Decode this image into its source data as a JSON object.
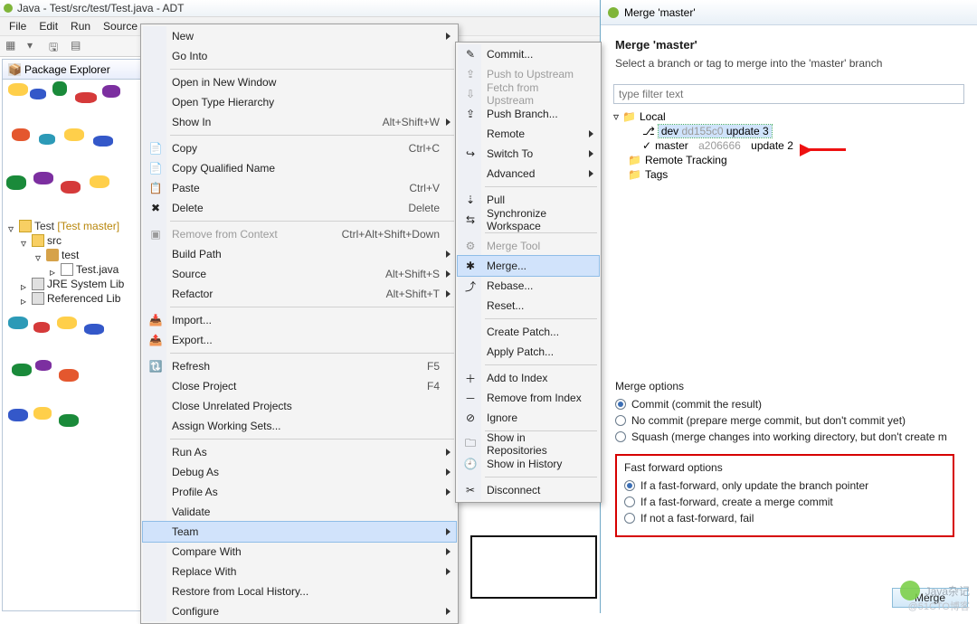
{
  "window": {
    "title": "Java - Test/src/test/Test.java - ADT"
  },
  "menubar": [
    "File",
    "Edit",
    "Run",
    "Source"
  ],
  "explorer": {
    "tab": "Package Explorer",
    "project": "Test",
    "project_deco": "[Test master]",
    "src": "src",
    "pkg": "test",
    "file": "Test.java",
    "jre": "JRE System Lib",
    "ref": "Referenced Lib"
  },
  "context": {
    "items": [
      {
        "label": "New",
        "arrow": true
      },
      {
        "label": "Go Into"
      },
      {
        "sep": true
      },
      {
        "label": "Open in New Window"
      },
      {
        "label": "Open Type Hierarchy"
      },
      {
        "label": "Show In",
        "sc": "Alt+Shift+W",
        "arrow": true
      },
      {
        "sep": true
      },
      {
        "label": "Copy",
        "sc": "Ctrl+C",
        "icon": "📄"
      },
      {
        "label": "Copy Qualified Name",
        "icon": "📄"
      },
      {
        "label": "Paste",
        "sc": "Ctrl+V",
        "icon": "📋"
      },
      {
        "label": "Delete",
        "sc": "Delete",
        "icon": "✖"
      },
      {
        "sep": true
      },
      {
        "label": "Remove from Context",
        "sc": "Ctrl+Alt+Shift+Down",
        "disabled": true,
        "icon": "▣"
      },
      {
        "label": "Build Path",
        "arrow": true
      },
      {
        "label": "Source",
        "sc": "Alt+Shift+S",
        "arrow": true
      },
      {
        "label": "Refactor",
        "sc": "Alt+Shift+T",
        "arrow": true
      },
      {
        "sep": true
      },
      {
        "label": "Import...",
        "icon": "📥"
      },
      {
        "label": "Export...",
        "icon": "📤"
      },
      {
        "sep": true
      },
      {
        "label": "Refresh",
        "sc": "F5",
        "icon": "🔃"
      },
      {
        "label": "Close Project",
        "sc": "F4"
      },
      {
        "label": "Close Unrelated Projects"
      },
      {
        "label": "Assign Working Sets..."
      },
      {
        "sep": true
      },
      {
        "label": "Run As",
        "arrow": true
      },
      {
        "label": "Debug As",
        "arrow": true
      },
      {
        "label": "Profile As",
        "arrow": true
      },
      {
        "label": "Validate"
      },
      {
        "label": "Team",
        "arrow": true,
        "hl": true
      },
      {
        "label": "Compare With",
        "arrow": true
      },
      {
        "label": "Replace With",
        "arrow": true
      },
      {
        "label": "Restore from Local History..."
      },
      {
        "label": "Configure",
        "arrow": true
      }
    ]
  },
  "submenu": {
    "items": [
      {
        "label": "Commit...",
        "icon": "✎"
      },
      {
        "label": "Push to Upstream",
        "disabled": true,
        "icon": "⇪"
      },
      {
        "label": "Fetch from Upstream",
        "disabled": true,
        "icon": "⇩"
      },
      {
        "label": "Push Branch...",
        "icon": "⇪"
      },
      {
        "label": "Remote",
        "arrow": true
      },
      {
        "label": "Switch To",
        "arrow": true,
        "icon": "↪"
      },
      {
        "label": "Advanced",
        "arrow": true
      },
      {
        "sep": true
      },
      {
        "label": "Pull",
        "icon": "⇣"
      },
      {
        "label": "Synchronize Workspace",
        "icon": "⇆"
      },
      {
        "sep": true
      },
      {
        "label": "Merge Tool",
        "disabled": true,
        "icon": "⚙"
      },
      {
        "label": "Merge...",
        "hl": true,
        "icon": "✱"
      },
      {
        "label": "Rebase...",
        "icon": "⤴"
      },
      {
        "label": "Reset..."
      },
      {
        "sep": true
      },
      {
        "label": "Create Patch..."
      },
      {
        "label": "Apply Patch..."
      },
      {
        "sep": true
      },
      {
        "label": "Add to Index",
        "icon": "＋"
      },
      {
        "label": "Remove from Index",
        "icon": "－"
      },
      {
        "label": "Ignore",
        "icon": "⊘"
      },
      {
        "sep": true
      },
      {
        "label": "Show in Repositories",
        "icon": "🗀"
      },
      {
        "label": "Show in History",
        "icon": "🕘"
      },
      {
        "sep": true
      },
      {
        "label": "Disconnect",
        "icon": "✂"
      }
    ]
  },
  "dialog": {
    "title": "Merge 'master'",
    "heading": "Merge 'master'",
    "subtitle": "Select a branch or tag to merge into the 'master' branch",
    "filter_placeholder": "type filter text",
    "tree": {
      "local": "Local",
      "dev": "dev",
      "dev_hash": "dd155c0",
      "dev_msg": "update 3",
      "master": "master",
      "master_hash": "a206666",
      "master_msg": "update 2",
      "remote": "Remote Tracking",
      "tags": "Tags"
    },
    "merge_options_title": "Merge options",
    "mo1": "Commit (commit the result)",
    "mo2": "No commit (prepare merge commit, but don't commit yet)",
    "mo3": "Squash (merge changes into working directory, but don't create m",
    "ff_title": "Fast forward options",
    "ff1": "If a fast-forward, only update the branch pointer",
    "ff2": "If a fast-forward, create a merge commit",
    "ff3": "If not a fast-forward, fail",
    "merge_btn": "Merge"
  },
  "watermark": {
    "text": "Java杂记",
    "sub": "@51CTO博客"
  }
}
